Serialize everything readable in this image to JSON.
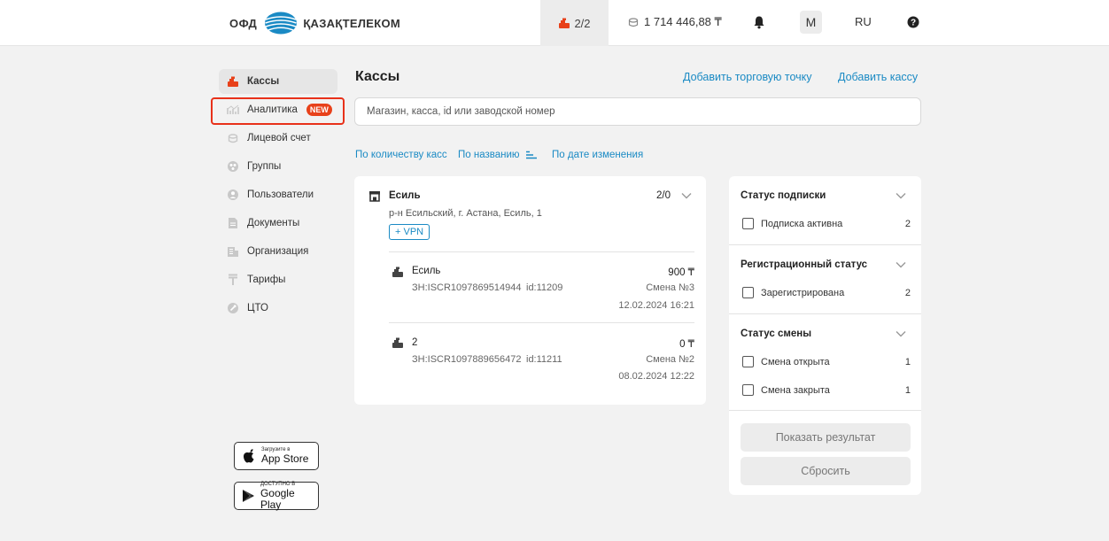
{
  "header": {
    "logo_ofd": "ОФД",
    "logo_company": "ҚАЗАҚТЕЛЕКОМ",
    "kassy_count": "2/2",
    "balance": "1 714 446,88 ₸",
    "avatar_letter": "M",
    "language": "RU"
  },
  "sidebar": {
    "items": [
      {
        "label": "Кассы",
        "icon": "cash-register-icon"
      },
      {
        "label": "Аналитика",
        "icon": "chart-icon",
        "badge": "NEW"
      },
      {
        "label": "Лицевой счет",
        "icon": "coins-icon"
      },
      {
        "label": "Группы",
        "icon": "group-icon"
      },
      {
        "label": "Пользователи",
        "icon": "user-icon"
      },
      {
        "label": "Документы",
        "icon": "document-icon"
      },
      {
        "label": "Организация",
        "icon": "building-icon"
      },
      {
        "label": "Тарифы",
        "icon": "tariff-icon"
      },
      {
        "label": "ЦТО",
        "icon": "service-icon"
      }
    ],
    "app_store": {
      "small": "Загрузите в",
      "big": "App Store"
    },
    "google_play": {
      "small": "ДОСТУПНО В",
      "big": "Google Play"
    }
  },
  "main": {
    "title": "Кассы",
    "add_point_link": "Добавить торговую точку",
    "add_kassa_link": "Добавить кассу",
    "search_placeholder": "Магазин, касса, id или заводской номер",
    "sort": {
      "by_count": "По количеству касс",
      "by_name": "По названию",
      "by_date": "По дате изменения"
    },
    "store": {
      "name": "Есиль",
      "address": "р-н Есильский, г. Астана, Есиль, 1",
      "tag": "+ VPN",
      "count": "2/0",
      "kassy": [
        {
          "name": "Есиль",
          "sn": "ЗН:ISCR1097869514944",
          "id": "id:11209",
          "amount": "900 ₸",
          "shift": "Смена №3",
          "date": "12.02.2024 16:21"
        },
        {
          "name": "2",
          "sn": "ЗН:ISCR1097889656472",
          "id": "id:11211",
          "amount": "0 ₸",
          "shift": "Смена №2",
          "date": "08.02.2024 12:22"
        }
      ]
    }
  },
  "filters": {
    "subscription": {
      "title": "Статус подписки",
      "options": [
        {
          "label": "Подписка активна",
          "count": "2"
        }
      ]
    },
    "registration": {
      "title": "Регистрационный статус",
      "options": [
        {
          "label": "Зарегистрирована",
          "count": "2"
        }
      ]
    },
    "shift": {
      "title": "Статус смены",
      "options": [
        {
          "label": "Смена открыта",
          "count": "1"
        },
        {
          "label": "Смена закрыта",
          "count": "1"
        }
      ]
    },
    "show_button": "Показать результат",
    "reset_button": "Сбросить"
  },
  "colors": {
    "accent": "#e8411a",
    "link": "#1a8ac4",
    "logo_blue": "#1a8ac4"
  }
}
